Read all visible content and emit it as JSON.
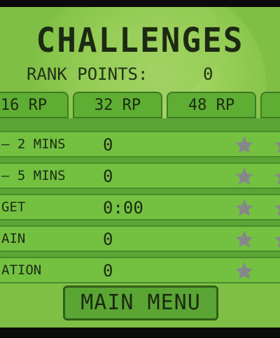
{
  "title": "CHALLENGES",
  "rank": {
    "label": "RANK POINTS:",
    "value": "0"
  },
  "tabs": [
    "16 RP",
    "32 RP",
    "48 RP",
    ""
  ],
  "challenges": [
    {
      "label": "– 2 MINS",
      "value": "0",
      "star": "star-icon"
    },
    {
      "label": "– 5 MINS",
      "value": "0",
      "star": "star-icon"
    },
    {
      "label": "GET",
      "value": "0:00",
      "star": "star-icon"
    },
    {
      "label": "AIN",
      "value": "0",
      "star": "star-icon"
    },
    {
      "label": "ATION",
      "value": "0",
      "star": "star-icon"
    }
  ],
  "buttons": {
    "main_menu": "MAIN MENU"
  },
  "colors": {
    "screen": "#7fbf45",
    "row": "#74c142",
    "text": "#1c2a12",
    "star": "#86878a"
  }
}
